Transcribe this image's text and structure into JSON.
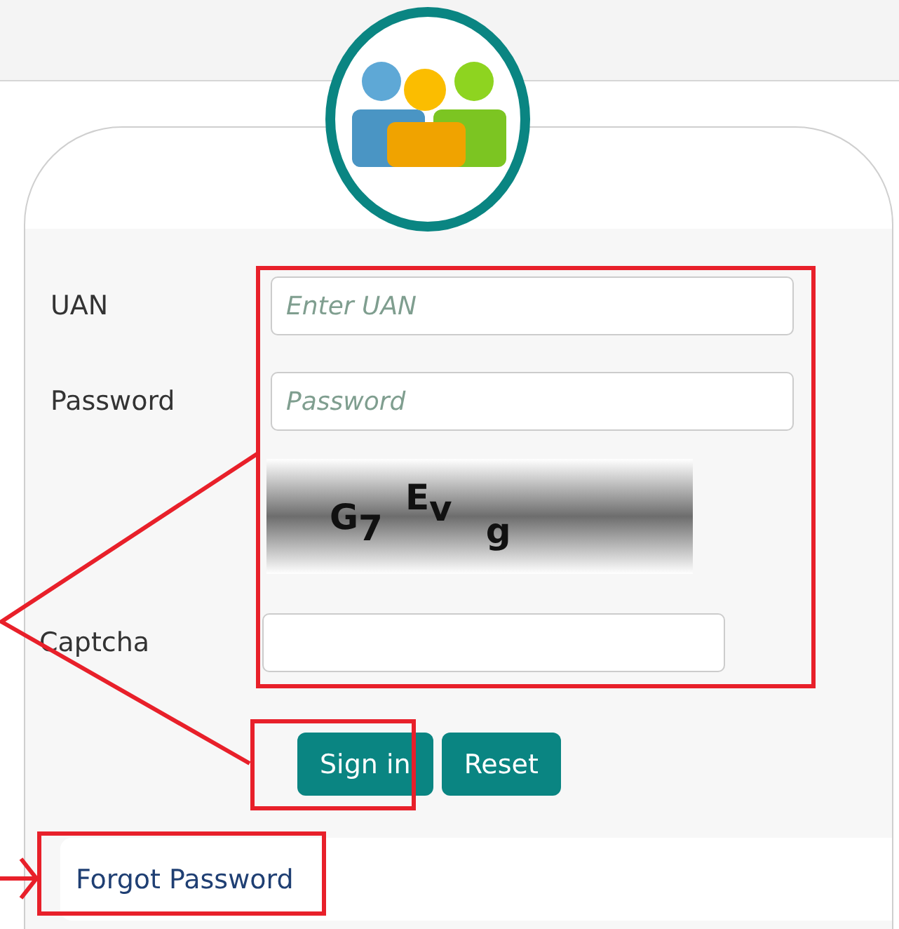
{
  "login_form": {
    "fields": [
      {
        "label": "UAN",
        "placeholder": "Enter UAN"
      },
      {
        "label": "Password",
        "placeholder": "Password"
      }
    ],
    "captcha": {
      "label": "Captcha",
      "characters": [
        "G",
        "7",
        "E",
        "v",
        "g"
      ]
    },
    "buttons": [
      "Sign in",
      "Reset"
    ],
    "forgot_link": "Forgot Password"
  }
}
